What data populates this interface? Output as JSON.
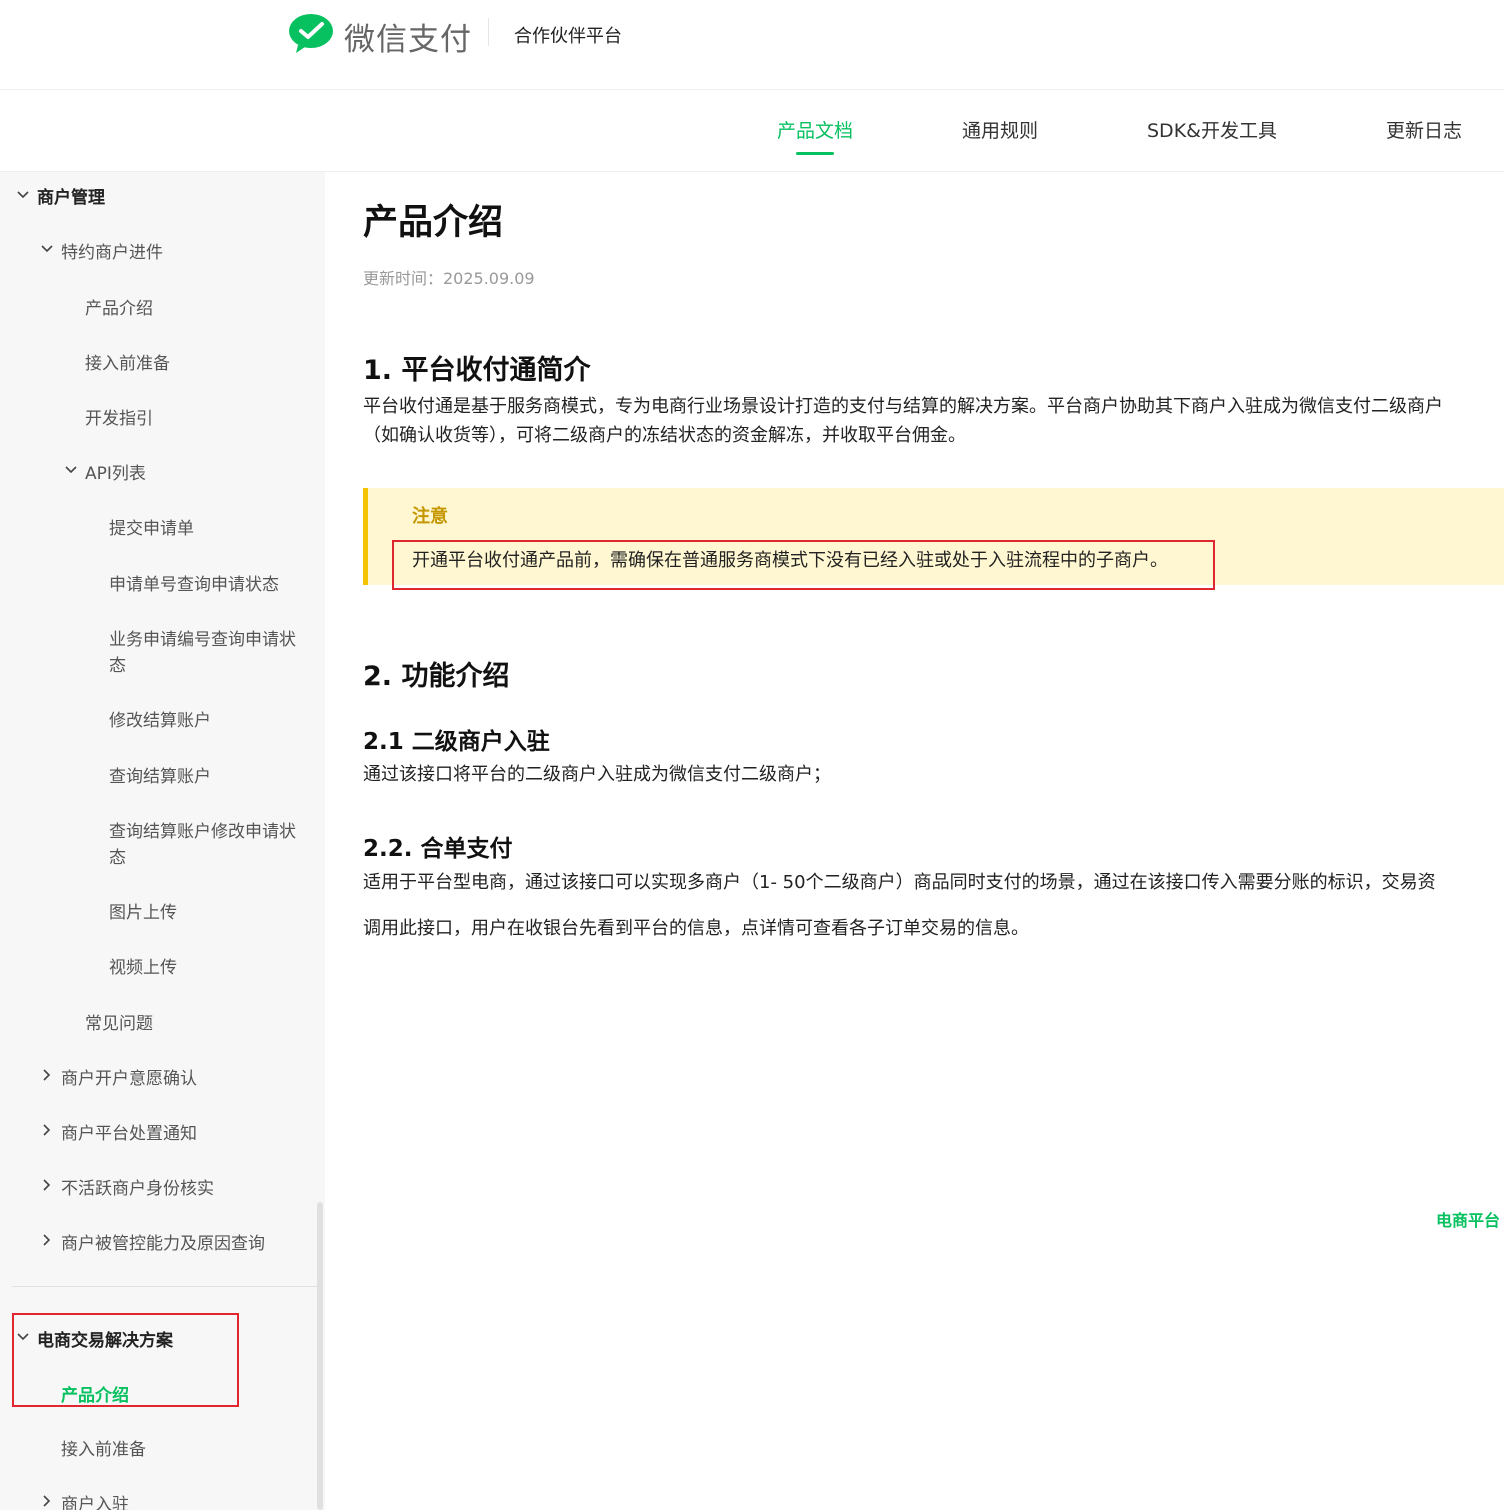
{
  "header": {
    "brand": "微信支付",
    "partner": "合作伙伴平台",
    "logo_icon": "wechat-pay-logo-icon",
    "brand_color": "#07c160"
  },
  "nav": {
    "tabs": [
      {
        "label": "产品文档",
        "active": true
      },
      {
        "label": "通用规则",
        "active": false
      },
      {
        "label": "SDK&开发工具",
        "active": false
      },
      {
        "label": "更新日志",
        "active": false
      }
    ]
  },
  "sidebar": {
    "items": [
      {
        "label": "商户管理",
        "expanded": true
      },
      {
        "label": "特约商户进件",
        "expanded": true
      },
      {
        "label": "产品介绍"
      },
      {
        "label": "接入前准备"
      },
      {
        "label": "开发指引"
      },
      {
        "label": "API列表",
        "expanded": true
      },
      {
        "label": "提交申请单"
      },
      {
        "label": "申请单号查询申请状态"
      },
      {
        "label": "业务申请编号查询申请状",
        "label2": "态"
      },
      {
        "label": "修改结算账户"
      },
      {
        "label": "查询结算账户"
      },
      {
        "label": "查询结算账户修改申请状",
        "label2": "态"
      },
      {
        "label": "图片上传"
      },
      {
        "label": "视频上传"
      },
      {
        "label": "常见问题"
      },
      {
        "label": "商户开户意愿确认",
        "expanded": false
      },
      {
        "label": "商户平台处置通知",
        "expanded": false
      },
      {
        "label": "不活跃商户身份核实",
        "expanded": false
      },
      {
        "label": "商户被管控能力及原因查询",
        "expanded": false
      },
      {
        "label": "电商交易解决方案",
        "expanded": true
      },
      {
        "label": "产品介绍",
        "active": true
      },
      {
        "label": "接入前准备"
      },
      {
        "label": "商户入驻",
        "expanded": false
      }
    ]
  },
  "main": {
    "title": "产品介绍",
    "updated": "更新时间：2025.09.09",
    "section1": {
      "heading": "1. 平台收付通简介",
      "para_line1": "平台收付通是基于服务商模式，专为电商行业场景设计打造的支付与结算的解决方案。平台商户协助其下商户入驻成为微信支付二级商户",
      "para_line2": "（如确认收货等），可将二级商户的冻结状态的资金解冻，并收取平台佣金。"
    },
    "note": {
      "title": "注意",
      "text": "开通平台收付通产品前，需确保在普通服务商模式下没有已经入驻或处于入驻流程中的子商户。"
    },
    "section2": {
      "heading": "2. 功能介绍",
      "sub1_heading": "2.1 二级商户入驻",
      "sub1_text": "通过该接口将平台的二级商户入驻成为微信支付二级商户；",
      "sub2_heading": "2.2. 合单支付",
      "sub2_text1": "适用于平台型电商，通过该接口可以实现多商户（1- 50个二级商户）商品同时支付的场景，通过在该接口传入需要分账的标识，交易资",
      "sub2_text2": "调用此接口，用户在收银台先看到平台的信息，点详情可查看各子订单交易的信息。"
    },
    "floating_link": "电商平台"
  }
}
